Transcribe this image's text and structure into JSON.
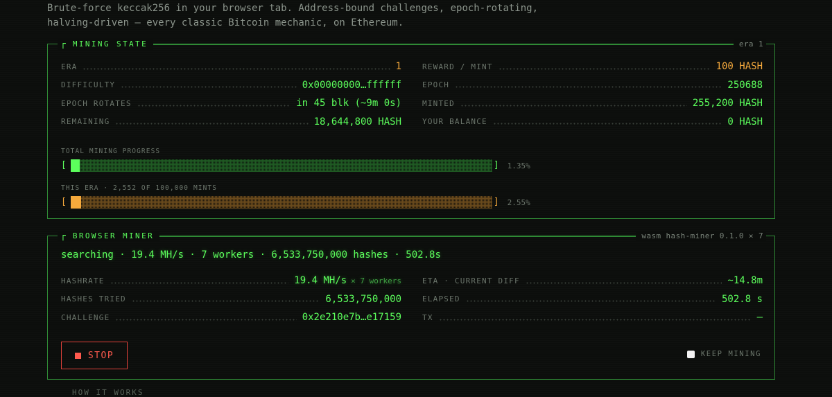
{
  "intro": {
    "line1": "Brute-force keccak256 in your browser tab. Address-bound challenges, epoch-rotating,",
    "line2": "halving-driven — every classic Bitcoin mechanic, on Ethereum."
  },
  "mining_state": {
    "title": "MINING STATE",
    "meta": "era 1",
    "left": [
      {
        "label": "ERA",
        "value": "1"
      },
      {
        "label": "DIFFICULTY",
        "value": "0x00000000…ffffff"
      },
      {
        "label": "EPOCH ROTATES",
        "value": "in 45 blk (~9m 0s)"
      },
      {
        "label": "REMAINING",
        "value": "18,644,800 HASH"
      }
    ],
    "right": [
      {
        "label": "REWARD / MINT",
        "value": "100 HASH"
      },
      {
        "label": "EPOCH",
        "value": "250688"
      },
      {
        "label": "MINTED",
        "value": "255,200 HASH"
      },
      {
        "label": "YOUR BALANCE",
        "value": "0 HASH"
      }
    ],
    "total_progress": {
      "label": "TOTAL MINING PROGRESS",
      "percent_text": "1.35%",
      "fraction": 0.0135
    },
    "era_progress": {
      "label": "THIS ERA · 2,552 OF 100,000 MINTS",
      "percent_text": "2.55%",
      "fraction": 0.0255
    },
    "bracket_open": "[",
    "bracket_close": "]"
  },
  "browser_miner": {
    "title": "BROWSER MINER",
    "meta": "wasm hash-miner 0.1.0 × 7",
    "status": "searching · 19.4 MH/s · 7 workers · 6,533,750,000 hashes · 502.8s",
    "left": [
      {
        "label": "HASHRATE",
        "value": "19.4 MH/s",
        "sub": "× 7 workers"
      },
      {
        "label": "HASHES TRIED",
        "value": "6,533,750,000"
      },
      {
        "label": "CHALLENGE",
        "value": "0x2e210e7b…e17159"
      }
    ],
    "right": [
      {
        "label": "ETA · CURRENT DIFF",
        "value": "~14.8m"
      },
      {
        "label": "ELAPSED",
        "value": "502.8 s"
      },
      {
        "label": "TX",
        "value": "—"
      }
    ],
    "stop_label": "STOP",
    "keep_mining_label": "KEEP MINING",
    "keep_mining_checked": false
  },
  "next_section_peek": "HOW IT WORKS",
  "colors": {
    "accent_green": "#5cff5c",
    "accent_orange": "#f5a93c",
    "stop_red": "#ff5a4e",
    "border": "#2f8a35"
  },
  "icons": [
    "corner-bracket-icon",
    "stop-square-icon",
    "checkbox-icon"
  ]
}
